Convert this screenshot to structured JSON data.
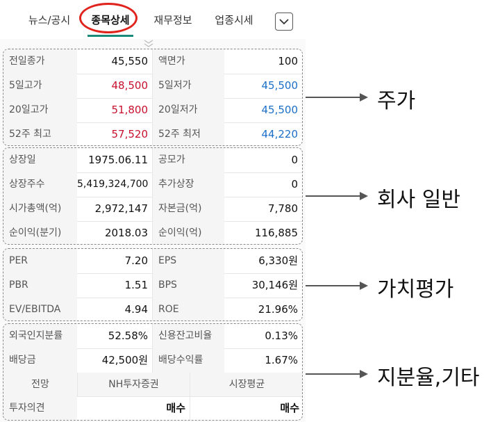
{
  "tabs": [
    {
      "label": "뉴스/공시"
    },
    {
      "label": "종목상세"
    },
    {
      "label": "재무정보"
    },
    {
      "label": "업종시세"
    }
  ],
  "sections": {
    "price": {
      "rows": [
        {
          "l1": "전일종가",
          "v1": "45,550",
          "l2": "액면가",
          "v2": "100"
        },
        {
          "l1": "5일고가",
          "v1": "48,500",
          "l2": "5일저가",
          "v2": "45,500"
        },
        {
          "l1": "20일고가",
          "v1": "51,800",
          "l2": "20일저가",
          "v2": "45,500"
        },
        {
          "l1": "52주 최고",
          "v1": "57,520",
          "l2": "52주 최저",
          "v2": "44,220"
        }
      ]
    },
    "company": {
      "rows": [
        {
          "l1": "상장일",
          "v1": "1975.06.11",
          "l2": "공모가",
          "v2": "0"
        },
        {
          "l1": "상장주수",
          "v1": "5,419,324,700",
          "l2": "추가상장",
          "v2": "0"
        },
        {
          "l1": "시가총액(억)",
          "v1": "2,972,147",
          "l2": "자본금(억)",
          "v2": "7,780"
        },
        {
          "l1": "순이익(분기)",
          "v1": "2018.03",
          "l2": "순이익(억)",
          "v2": "116,885"
        }
      ]
    },
    "valuation": {
      "rows": [
        {
          "l1": "PER",
          "v1": "7.20",
          "l2": "EPS",
          "v2": "6,330원"
        },
        {
          "l1": "PBR",
          "v1": "1.51",
          "l2": "BPS",
          "v2": "30,146원"
        },
        {
          "l1": "EV/EBITDA",
          "v1": "4.94",
          "l2": "ROE",
          "v2": "21.96%"
        }
      ]
    },
    "shares": {
      "rows": [
        {
          "l1": "외국인지분률",
          "v1": "52.58%",
          "l2": "신용잔고비율",
          "v2": "0.13%"
        },
        {
          "l1": "배당금",
          "v1": "42,500원",
          "l2": "배당수익률",
          "v2": "1.67%"
        }
      ],
      "opinion": {
        "head_label": "전망",
        "col1_header": "NH투자증권",
        "col2_header": "시장평균",
        "row_label": "투자의견",
        "col1_value": "매수",
        "col2_value": "매수"
      }
    }
  },
  "annotations": {
    "price": "주가",
    "company": "회사 일반",
    "valuation": "가치평가",
    "shares": "지분율,기타"
  },
  "colors": {
    "up": "#c8102e",
    "down": "#1c6fc7",
    "active_tab_underline": "#1a8a7a",
    "highlight_circle": "#e0231c"
  },
  "icons": {
    "dropdown": "chevron-down-icon",
    "drag": "double-chevron-down-icon"
  }
}
